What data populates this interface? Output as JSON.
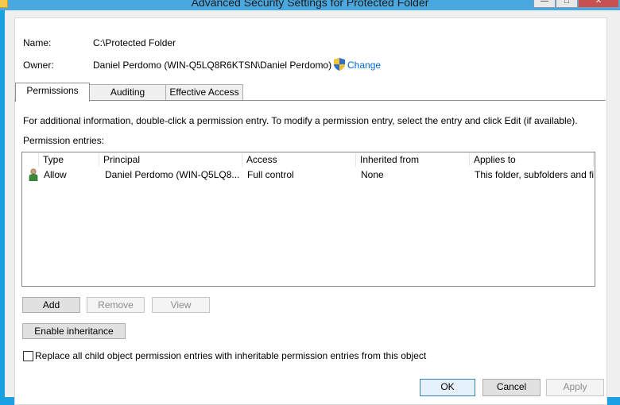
{
  "window": {
    "title": "Advanced Security Settings for Protected Folder",
    "controls": [
      "—",
      "□",
      "✕"
    ]
  },
  "info": {
    "name_label": "Name:",
    "name_value": "C:\\Protected Folder",
    "owner_label": "Owner:",
    "owner_value": "Daniel Perdomo (WIN-Q5LQ8R6KTSN\\Daniel Perdomo)",
    "change_link": "Change"
  },
  "tabs": [
    {
      "label": "Permissions",
      "active": true
    },
    {
      "label": "Auditing",
      "active": false
    },
    {
      "label": "Effective Access",
      "active": false
    }
  ],
  "permissions": {
    "instructions": "For additional information, double-click a permission entry. To modify a permission entry, select the entry and click Edit (if available).",
    "entries_label": "Permission entries:",
    "columns": [
      "Type",
      "Principal",
      "Access",
      "Inherited from",
      "Applies to"
    ],
    "rows": [
      {
        "type": "Allow",
        "principal": "Daniel Perdomo (WIN-Q5LQ8...",
        "access": "Full control",
        "inherited_from": "None",
        "applies_to": "This folder, subfolders and files"
      }
    ],
    "buttons": {
      "add": "Add",
      "remove": "Remove",
      "view": "View"
    },
    "enable_inheritance": "Enable inheritance",
    "replace_checkbox": {
      "label": "Replace all child object permission entries with inheritable permission entries from this object",
      "checked": false
    }
  },
  "dialog_buttons": {
    "ok": "OK",
    "cancel": "Cancel",
    "apply": "Apply"
  },
  "colors": {
    "accent": "#1ba1e2",
    "link": "#0066cc"
  }
}
